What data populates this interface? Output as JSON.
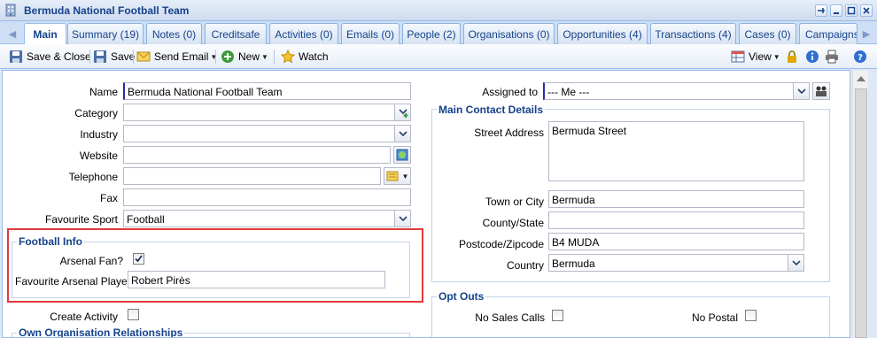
{
  "window": {
    "title": "Bermuda National Football Team"
  },
  "tabs": [
    {
      "label": "Main",
      "active": true
    },
    {
      "label": "Summary (19)"
    },
    {
      "label": "Notes (0)"
    },
    {
      "label": "Creditsafe"
    },
    {
      "label": "Activities (0)"
    },
    {
      "label": "Emails (0)"
    },
    {
      "label": "People (2)"
    },
    {
      "label": "Organisations (0)"
    },
    {
      "label": "Opportunities (4)"
    },
    {
      "label": "Transactions (4)"
    },
    {
      "label": "Cases (0)"
    },
    {
      "label": "Campaigns"
    }
  ],
  "toolbar": {
    "save_close": "Save & Close",
    "save": "Save",
    "send_email": "Send Email",
    "new": "New",
    "watch": "Watch",
    "view": "View"
  },
  "form": {
    "name": {
      "label": "Name",
      "value": "Bermuda National Football Team"
    },
    "category": {
      "label": "Category",
      "value": ""
    },
    "industry": {
      "label": "Industry",
      "value": ""
    },
    "website": {
      "label": "Website",
      "value": ""
    },
    "telephone": {
      "label": "Telephone",
      "value": ""
    },
    "fax": {
      "label": "Fax",
      "value": ""
    },
    "favourite_sport": {
      "label": "Favourite Sport",
      "value": "Football"
    },
    "football_info": {
      "legend": "Football Info",
      "arsenal_fan": {
        "label": "Arsenal Fan?",
        "checked": true
      },
      "favourite_player": {
        "label": "Favourite Arsenal Player",
        "value": "Robert Pirès"
      }
    },
    "create_activity": {
      "label": "Create Activity",
      "checked": false
    },
    "own_org_relationships": {
      "legend": "Own Organisation Relationships"
    },
    "assigned_to": {
      "label": "Assigned to",
      "value": "--- Me ---"
    },
    "main_contact": {
      "legend": "Main Contact Details",
      "street_address": {
        "label": "Street Address",
        "value": "Bermuda Street"
      },
      "town_city": {
        "label": "Town or City",
        "value": "Bermuda"
      },
      "county_state": {
        "label": "County/State",
        "value": ""
      },
      "postcode": {
        "label": "Postcode/Zipcode",
        "value": "B4 MUDA"
      },
      "country": {
        "label": "Country",
        "value": "Bermuda"
      }
    },
    "opt_outs": {
      "legend": "Opt Outs",
      "no_sales_calls": {
        "label": "No Sales Calls",
        "checked": false
      },
      "no_postal": {
        "label": "No Postal",
        "checked": false
      }
    }
  },
  "colors": {
    "accent": "#15428b",
    "highlight": "#e03a3a",
    "border": "#99bbe8"
  }
}
